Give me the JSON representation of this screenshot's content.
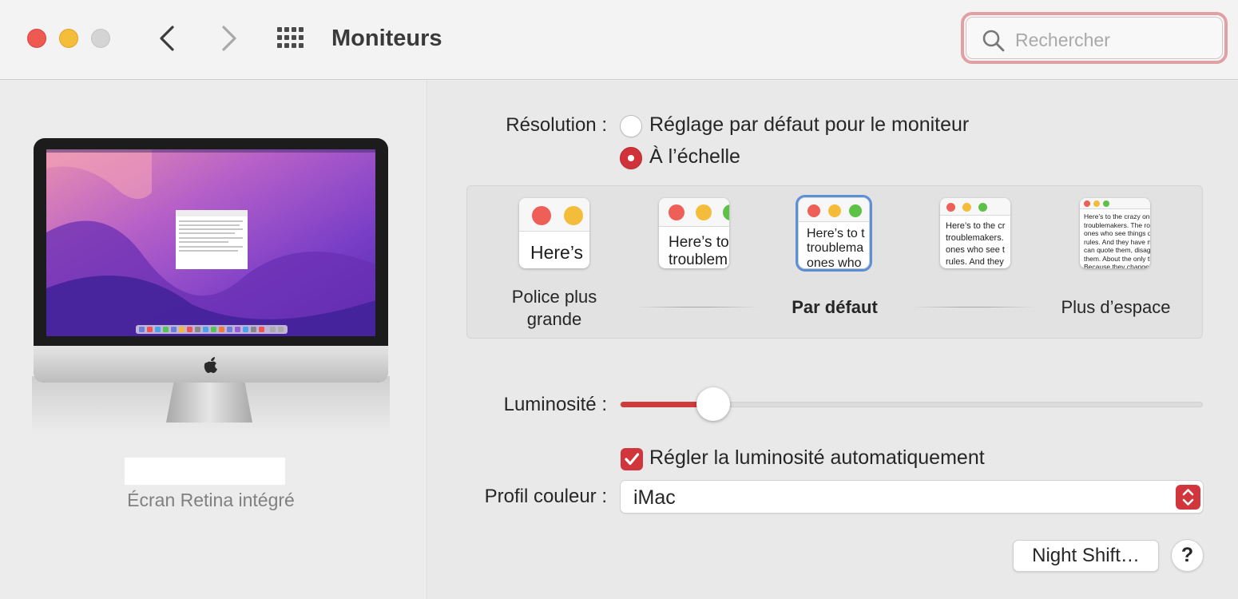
{
  "window": {
    "title": "Moniteurs",
    "search_placeholder": "Rechercher"
  },
  "display": {
    "name": "Écran Retina intégré"
  },
  "resolution": {
    "label": "Résolution :",
    "options": [
      {
        "label": "Réglage par défaut pour le moniteur",
        "selected": false
      },
      {
        "label": "À l’échelle",
        "selected": true
      }
    ],
    "scale": {
      "thumb_texts": [
        "Here’s",
        "Here’s to\ntroublem",
        "Here’s to t\ntroublema\nones who",
        "Here’s to the cr\ntroublemakers.\nones who see t\nrules. And they",
        "Here’s to the crazy ones\ntroublemakers. The rou\nones who see things dif\nrules. And they have no\ncan quote them, disagre\nthem. About the only th\nBecause they change th"
      ],
      "selected_index": 2,
      "label_left": "Police plus\ngrande",
      "label_center": "Par défaut",
      "label_right": "Plus d’espace"
    }
  },
  "brightness": {
    "label": "Luminosité :",
    "value": 0.16,
    "auto_label": "Régler la luminosité automatiquement",
    "auto_checked": true
  },
  "color_profile": {
    "label": "Profil couleur :",
    "value": "iMac"
  },
  "buttons": {
    "night_shift": "Night Shift…",
    "help": "?"
  },
  "colors": {
    "accent": "#d1363c",
    "selection": "#5b8fd6"
  }
}
